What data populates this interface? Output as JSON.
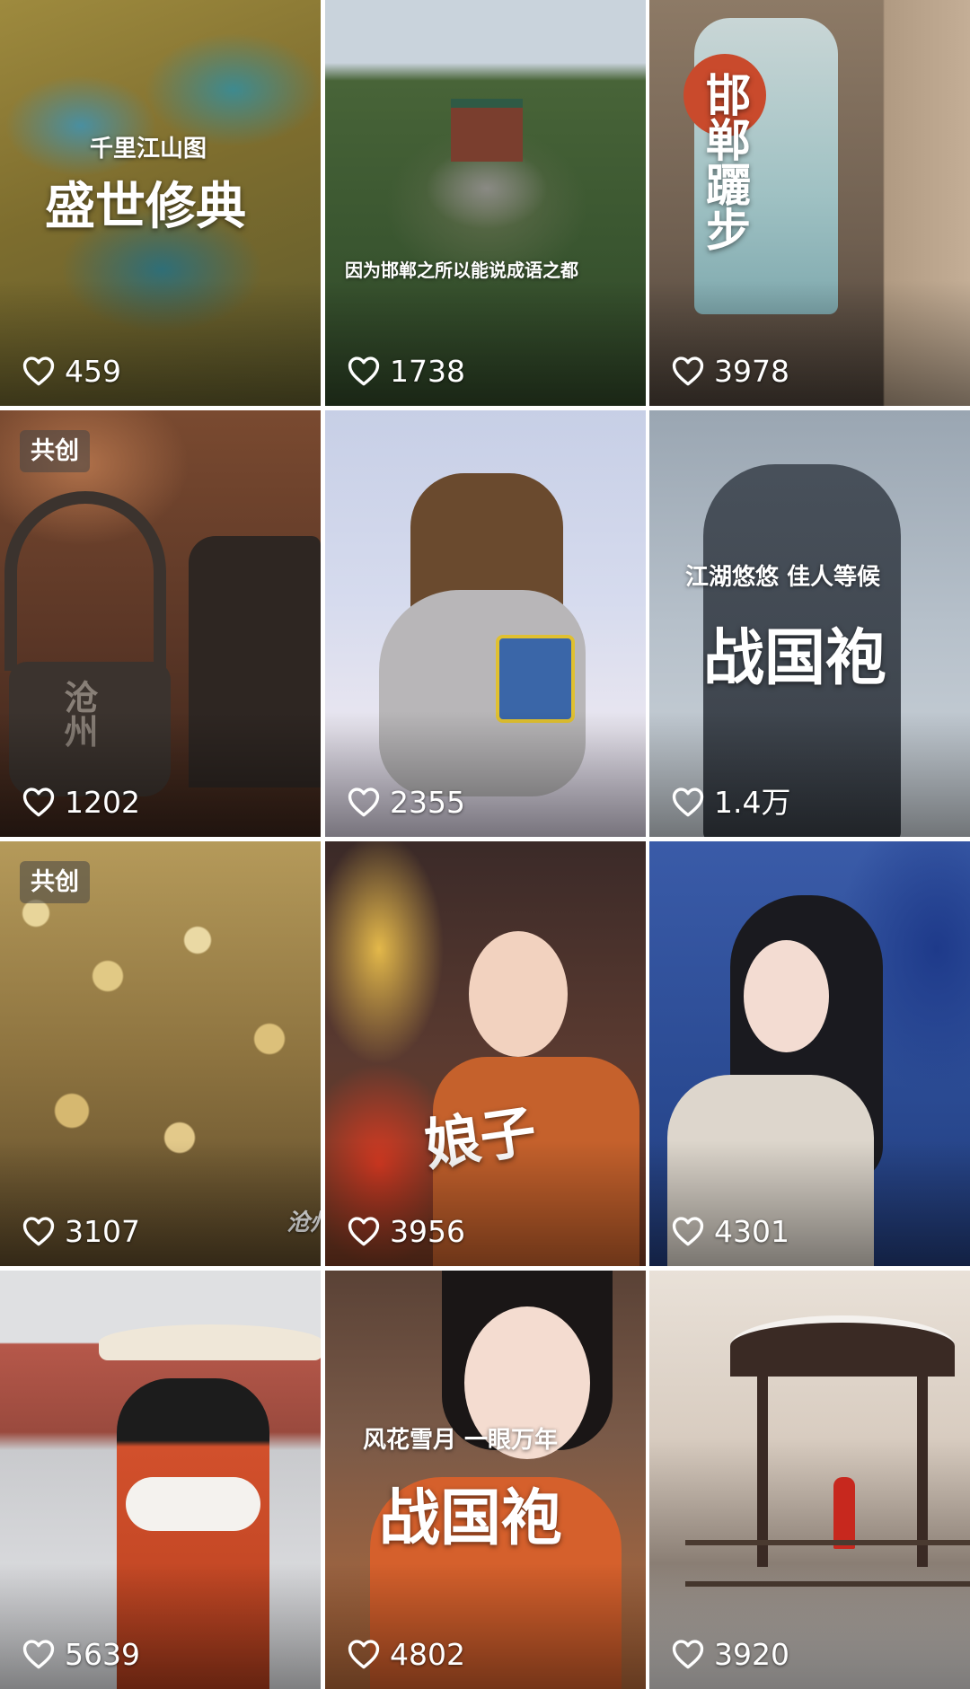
{
  "videos": [
    {
      "likes": "459",
      "title": "盛世修典",
      "subtitle": "千里江山图",
      "badge": ""
    },
    {
      "likes": "1738",
      "title": "",
      "subtitle": "因为邯郸之所以能说成语之都",
      "badge": ""
    },
    {
      "likes": "3978",
      "title": "邯郸躧步",
      "subtitle": "",
      "badge": ""
    },
    {
      "likes": "1202",
      "title": "",
      "subtitle": "",
      "badge": "共创",
      "mark": "沧州"
    },
    {
      "likes": "2355",
      "title": "",
      "subtitle": "",
      "badge": ""
    },
    {
      "likes": "1.4万",
      "title": "战国袍",
      "subtitle": "江湖悠悠 佳人等候",
      "badge": ""
    },
    {
      "likes": "3107",
      "title": "",
      "subtitle": "",
      "badge": "共创",
      "mark": "沧州"
    },
    {
      "likes": "3956",
      "title": "娘子",
      "subtitle": "",
      "badge": ""
    },
    {
      "likes": "4301",
      "title": "",
      "subtitle": "",
      "badge": ""
    },
    {
      "likes": "5639",
      "title": "",
      "subtitle": "",
      "badge": ""
    },
    {
      "likes": "4802",
      "title": "战国袍",
      "subtitle": "风花雪月 一眼万年",
      "badge": ""
    },
    {
      "likes": "3920",
      "title": "",
      "subtitle": "",
      "badge": ""
    }
  ],
  "colors": {
    "background": "#ffffff",
    "overlay_text": "#ffffff",
    "badge_bg": "#464646"
  },
  "icons": {
    "like": "heart-outline-icon"
  }
}
